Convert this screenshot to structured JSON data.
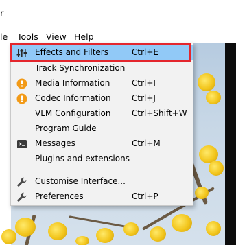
{
  "window": {
    "title_fragment": "r"
  },
  "menubar": {
    "items": [
      {
        "label": "le"
      },
      {
        "label": "Tools"
      },
      {
        "label": "View"
      },
      {
        "label": "Help"
      }
    ]
  },
  "tools_menu": {
    "items": [
      {
        "label": "Effects and Filters",
        "shortcut": "Ctrl+E",
        "icon": "equalizer-sliders-icon",
        "highlighted": true
      },
      {
        "label": "Track Synchronization",
        "shortcut": "",
        "icon": ""
      },
      {
        "label": "Media Information",
        "shortcut": "Ctrl+I",
        "icon": "info-orange-icon"
      },
      {
        "label": "Codec Information",
        "shortcut": "Ctrl+J",
        "icon": "info-orange-icon"
      },
      {
        "label": "VLM Configuration",
        "shortcut": "Ctrl+Shift+W",
        "icon": ""
      },
      {
        "label": "Program Guide",
        "shortcut": "",
        "icon": ""
      },
      {
        "label": "Messages",
        "shortcut": "Ctrl+M",
        "icon": "terminal-icon"
      },
      {
        "label": "Plugins and extensions",
        "shortcut": "",
        "icon": ""
      },
      {
        "label": "Customise Interface...",
        "shortcut": "",
        "icon": "wrench-icon"
      },
      {
        "label": "Preferences",
        "shortcut": "Ctrl+P",
        "icon": "wrench-icon"
      }
    ]
  },
  "colors": {
    "highlight": "#91c9f7",
    "annotation_border": "#e4262d",
    "menu_background": "#f2f2f2"
  }
}
